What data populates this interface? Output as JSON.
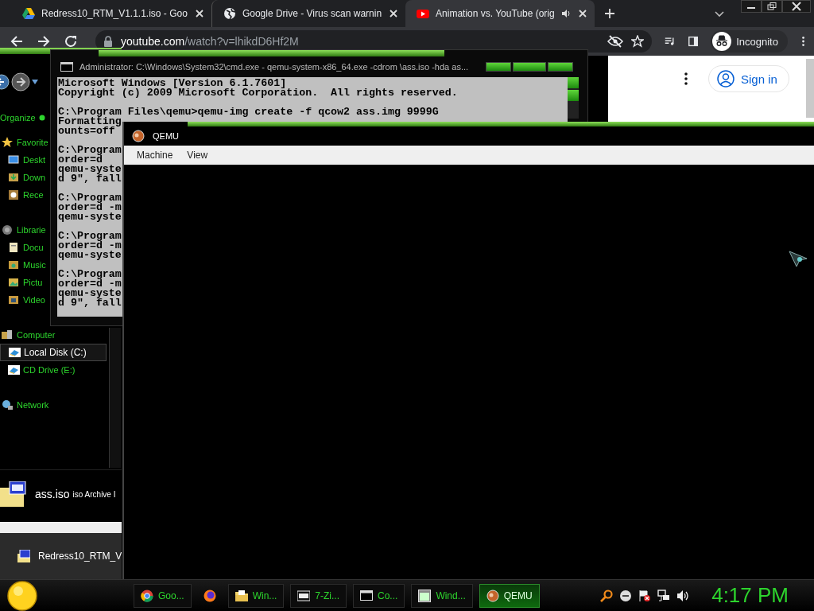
{
  "browser": {
    "tabs": [
      {
        "title": "Redress10_RTM_V1.1.1.iso - Goo",
        "selected": false,
        "audio": false
      },
      {
        "title": "Google Drive - Virus scan warnin",
        "selected": false,
        "audio": false
      },
      {
        "title": "Animation vs. YouTube (orig",
        "selected": true,
        "audio": true
      }
    ],
    "address": {
      "host": "youtube.com",
      "path": "/watch?v=lhikdD6Hf2M"
    },
    "profile": "Incognito"
  },
  "page": {
    "sign_in": "Sign in"
  },
  "explorer": {
    "organize": "Organize",
    "nav": [
      {
        "label": "Favorite",
        "selected": false,
        "children": [
          {
            "label": "Deskt",
            "selected": false
          },
          {
            "label": "Down",
            "selected": false
          },
          {
            "label": "Rece",
            "selected": false
          }
        ]
      },
      {
        "label": "Librarie",
        "selected": false,
        "children": [
          {
            "label": "Docu",
            "selected": false
          },
          {
            "label": "Music",
            "selected": false
          },
          {
            "label": "Pictu",
            "selected": false
          },
          {
            "label": "Video",
            "selected": false
          }
        ]
      },
      {
        "label": "Computer",
        "selected": false,
        "children": [
          {
            "label": "Local Disk (C:)",
            "selected": true
          },
          {
            "label": "CD Drive (E:)",
            "selected": false
          }
        ]
      },
      {
        "label": "Network",
        "selected": false
      }
    ],
    "details": {
      "name": "ass.iso",
      "type": "iso Archive I"
    }
  },
  "downloads": [
    {
      "name": "Redress10_RTM_V"
    }
  ],
  "cmd": {
    "title": "Administrator: C:\\Windows\\System32\\cmd.exe - qemu-system-x86_64.exe  -cdrom \\ass.iso -hda as...",
    "blocks": [
      [
        "Microsoft Windows [Version 6.1.7601]",
        "Copyright (c) 2009 Microsoft Corporation.  All rights reserved."
      ],
      [
        "C:\\Program Files\\qemu>qemu-img create -f qcow2 ass.img 9999G",
        "Formatting",
        "ounts=off"
      ],
      [
        "C:\\Program",
        "order=d",
        "qemu-syste",
        "d 9\", fall"
      ],
      [
        "C:\\Program",
        "order=d -m",
        "qemu-syste"
      ],
      [
        "C:\\Program",
        "order=d -m",
        "qemu-syste"
      ],
      [
        "C:\\Program",
        "order=d -m",
        "qemu-syste",
        "d 9\", fall"
      ]
    ]
  },
  "qemu": {
    "title": "QEMU",
    "menu": [
      "Machine",
      "View"
    ]
  },
  "taskbar": {
    "items": [
      {
        "label": "Goo...",
        "selected": false
      },
      {
        "selected": false
      },
      {
        "label": "Win...",
        "selected": false
      },
      {
        "label": "7-Zi...",
        "selected": false
      },
      {
        "label": "Co...",
        "selected": false
      },
      {
        "label": "Wind...",
        "selected": false
      },
      {
        "label": "QEMU",
        "selected": true
      }
    ],
    "clock": "4:17 PM"
  }
}
